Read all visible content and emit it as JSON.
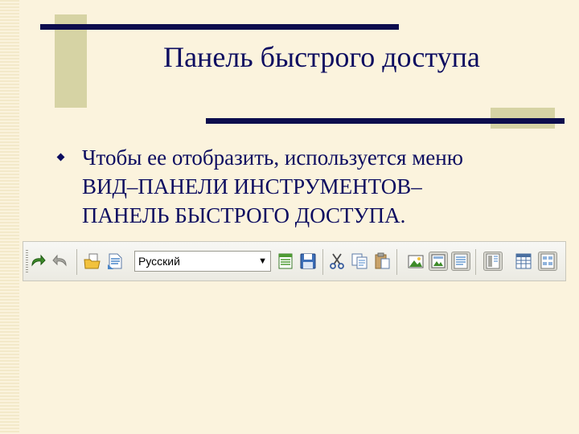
{
  "slide": {
    "title": "Панель быстрого доступа",
    "bullet_text_line1": "Чтобы ее отобразить, используется меню",
    "bullet_text_line2": "ВИД–ПАНЕЛИ ИНСТРУМЕНТОВ–",
    "bullet_text_line3": "ПАНЕЛЬ БЫСТРОГО ДОСТУПА."
  },
  "toolbar": {
    "language_select_value": "Русский",
    "icons": [
      "redo-icon",
      "undo-icon",
      "open-folder-icon",
      "new-document-icon",
      "language-select",
      "table-list-icon",
      "save-icon",
      "cut-icon",
      "copy-icon",
      "paste-icon",
      "image-icon",
      "picture-frame-icon",
      "text-lines-icon",
      "page-layout-icon",
      "grid-table-icon",
      "form-icon"
    ]
  },
  "colors": {
    "background": "#fbf3dd",
    "text": "#0c0c60",
    "decor_line": "#0d0d4d",
    "decor_block": "#d6d3a4"
  }
}
